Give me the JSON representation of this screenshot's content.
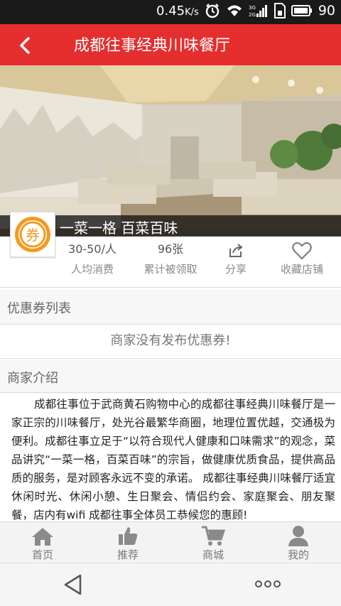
{
  "status_bar": {
    "speed": "0.45",
    "speed_unit": "K/s",
    "battery": "90",
    "icons": [
      "alarm-icon",
      "wifi-icon",
      "signal-icon",
      "sim-icon",
      "battery-icon"
    ]
  },
  "header": {
    "title": "成都往事经典川味餐厅"
  },
  "shop": {
    "slogan": "一菜一格 百菜百味",
    "logo_char": "券"
  },
  "stats": {
    "avg_price": "30-50/人",
    "avg_price_label": "人均消费",
    "claimed": "96张",
    "claimed_label": "累计被领取",
    "share_label": "分享",
    "favorite_label": "收藏店铺"
  },
  "coupons": {
    "title": "优惠券列表",
    "empty_message": "商家没有发布优惠券!"
  },
  "intro": {
    "title": "商家介绍",
    "text": "成都往事位于武商黄石购物中心的成都往事经典川味餐厅是一家正宗的川味餐厅，处光谷最繁华商圈，地理位置优越，交通极为便利。成都往事立足于“以符合现代人健康和口味需求”的观念，菜品讲究“一菜一格，百菜百味”的宗旨，做健康优质食品，提供高品质的服务，是对顾客永远不变的承诺。 成都往事经典川味餐厅适宜休闲时光、休闲小憩、生日聚会、情侣约会、家庭聚会、朋友聚餐，店内有wifi 成都往事全体员工恭候您的惠顾!"
  },
  "tabs": [
    {
      "label": "首页",
      "icon": "home-icon"
    },
    {
      "label": "推荐",
      "icon": "thumbs-up-icon"
    },
    {
      "label": "商城",
      "icon": "cart-icon"
    },
    {
      "label": "我的",
      "icon": "user-icon"
    }
  ],
  "colors": {
    "header_red": "#e52e2e",
    "logo_orange": "#f39a1e"
  }
}
